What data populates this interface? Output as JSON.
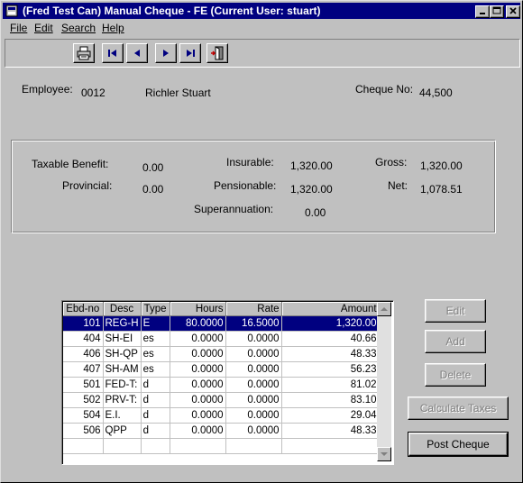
{
  "window": {
    "title": "(Fred Test Can) Manual Cheque - FE (Current User: stuart)",
    "controls": {
      "minimize": "_",
      "maximize": "□",
      "close": "✕"
    }
  },
  "menu": [
    "File",
    "Edit",
    "Search",
    "Help"
  ],
  "toolbar": {
    "icons": [
      "printer-icon",
      "first-record-icon",
      "previous-record-icon",
      "next-record-icon",
      "last-record-icon",
      "exit-door-icon"
    ]
  },
  "employee": {
    "label": "Employee:",
    "id": "0012",
    "name": "Richler Stuart"
  },
  "cheque": {
    "label": "Cheque No:",
    "number": "44,500"
  },
  "summary": {
    "taxable_benefit_label": "Taxable Benefit:",
    "taxable_benefit": "0.00",
    "provincial_label": "Provincial:",
    "provincial": "0.00",
    "insurable_label": "Insurable:",
    "insurable": "1,320.00",
    "pensionable_label": "Pensionable:",
    "pensionable": "1,320.00",
    "gross_label": "Gross:",
    "gross": "1,320.00",
    "net_label": "Net:",
    "net": "1,078.51",
    "superannuation_label": "Superannuation:",
    "superannuation": "0.00"
  },
  "grid": {
    "columns": [
      "Ebd-no",
      "Desc",
      "Type",
      "Hours",
      "Rate",
      "Amount"
    ],
    "rows": [
      {
        "ebd": "101",
        "desc": "REG-H",
        "type": "E",
        "hours": "80.0000",
        "rate": "16.5000",
        "amount": "1,320.00"
      },
      {
        "ebd": "404",
        "desc": "SH-EI",
        "type": "es",
        "hours": "0.0000",
        "rate": "0.0000",
        "amount": "40.66"
      },
      {
        "ebd": "406",
        "desc": "SH-QP",
        "type": "es",
        "hours": "0.0000",
        "rate": "0.0000",
        "amount": "48.33"
      },
      {
        "ebd": "407",
        "desc": "SH-AM",
        "type": "es",
        "hours": "0.0000",
        "rate": "0.0000",
        "amount": "56.23"
      },
      {
        "ebd": "501",
        "desc": "FED-T:",
        "type": "d",
        "hours": "0.0000",
        "rate": "0.0000",
        "amount": "81.02"
      },
      {
        "ebd": "502",
        "desc": "PRV-T:",
        "type": "d",
        "hours": "0.0000",
        "rate": "0.0000",
        "amount": "83.10"
      },
      {
        "ebd": "504",
        "desc": "E.I.",
        "type": "d",
        "hours": "0.0000",
        "rate": "0.0000",
        "amount": "29.04"
      },
      {
        "ebd": "506",
        "desc": "QPP",
        "type": "d",
        "hours": "0.0000",
        "rate": "0.0000",
        "amount": "48.33"
      }
    ],
    "selected_row": 0
  },
  "buttons": {
    "edit": "Edit",
    "add": "Add",
    "delete": "Delete",
    "calculate_taxes": "Calculate Taxes",
    "post_cheque": "Post Cheque"
  }
}
